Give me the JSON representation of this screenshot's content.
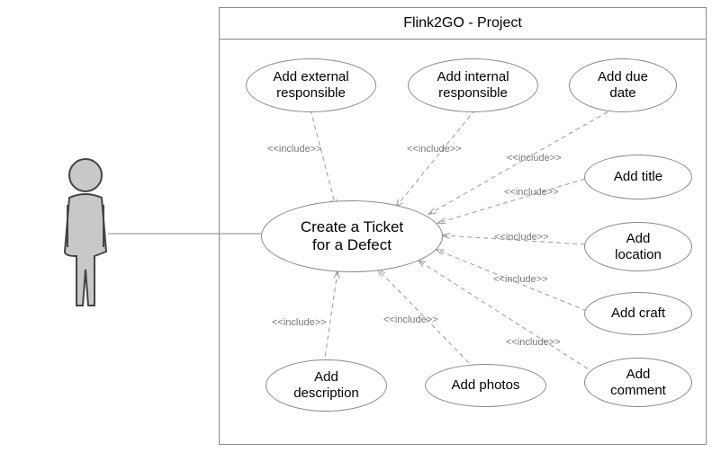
{
  "system_title": "Flink2GO - Project",
  "central_usecase": "Create a Ticket\nfor a Defect",
  "usecases": {
    "add_external_responsible": "Add external\nresponsible",
    "add_internal_responsible": "Add internal\nresponsible",
    "add_due_date": "Add due\ndate",
    "add_title": "Add title",
    "add_location": "Add\nlocation",
    "add_craft": "Add craft",
    "add_comment": "Add\ncomment",
    "add_photos": "Add photos",
    "add_description": "Add\ndescription"
  },
  "include_label": "<<include>>"
}
